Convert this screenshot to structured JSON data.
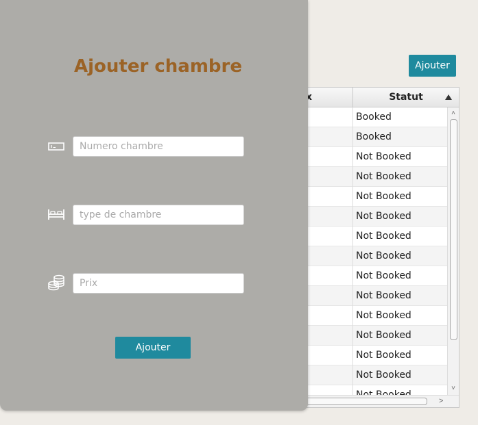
{
  "background": {
    "add_button_label": "Ajouter",
    "table": {
      "columns": [
        {
          "key": "prix",
          "label": "x"
        },
        {
          "key": "statut",
          "label": "Statut",
          "sort": "ascending"
        }
      ],
      "rows": [
        {
          "statut": "Booked"
        },
        {
          "statut": "Booked"
        },
        {
          "statut": "Not Booked"
        },
        {
          "statut": "Not Booked"
        },
        {
          "statut": "Not Booked"
        },
        {
          "statut": "Not Booked"
        },
        {
          "statut": "Not Booked"
        },
        {
          "statut": "Not Booked"
        },
        {
          "statut": "Not Booked"
        },
        {
          "statut": "Not Booked"
        },
        {
          "statut": "Not Booked"
        },
        {
          "statut": "Not Booked"
        },
        {
          "statut": "Not Booked"
        },
        {
          "statut": "Not Booked"
        },
        {
          "statut": "Not Booked"
        }
      ]
    }
  },
  "dialog": {
    "title": "Ajouter chambre",
    "fields": [
      {
        "icon": "ticket-icon",
        "value": "",
        "placeholder": "Numero chambre"
      },
      {
        "icon": "bed-icon",
        "value": "",
        "placeholder": "type de chambre"
      },
      {
        "icon": "coins-icon",
        "value": "",
        "placeholder": "Prix"
      }
    ],
    "submit_label": "Ajouter"
  },
  "colors": {
    "accent": "#1f8a9e",
    "title": "#9b6326",
    "dialog_background": "#adaca8",
    "window_background": "#efece7"
  }
}
